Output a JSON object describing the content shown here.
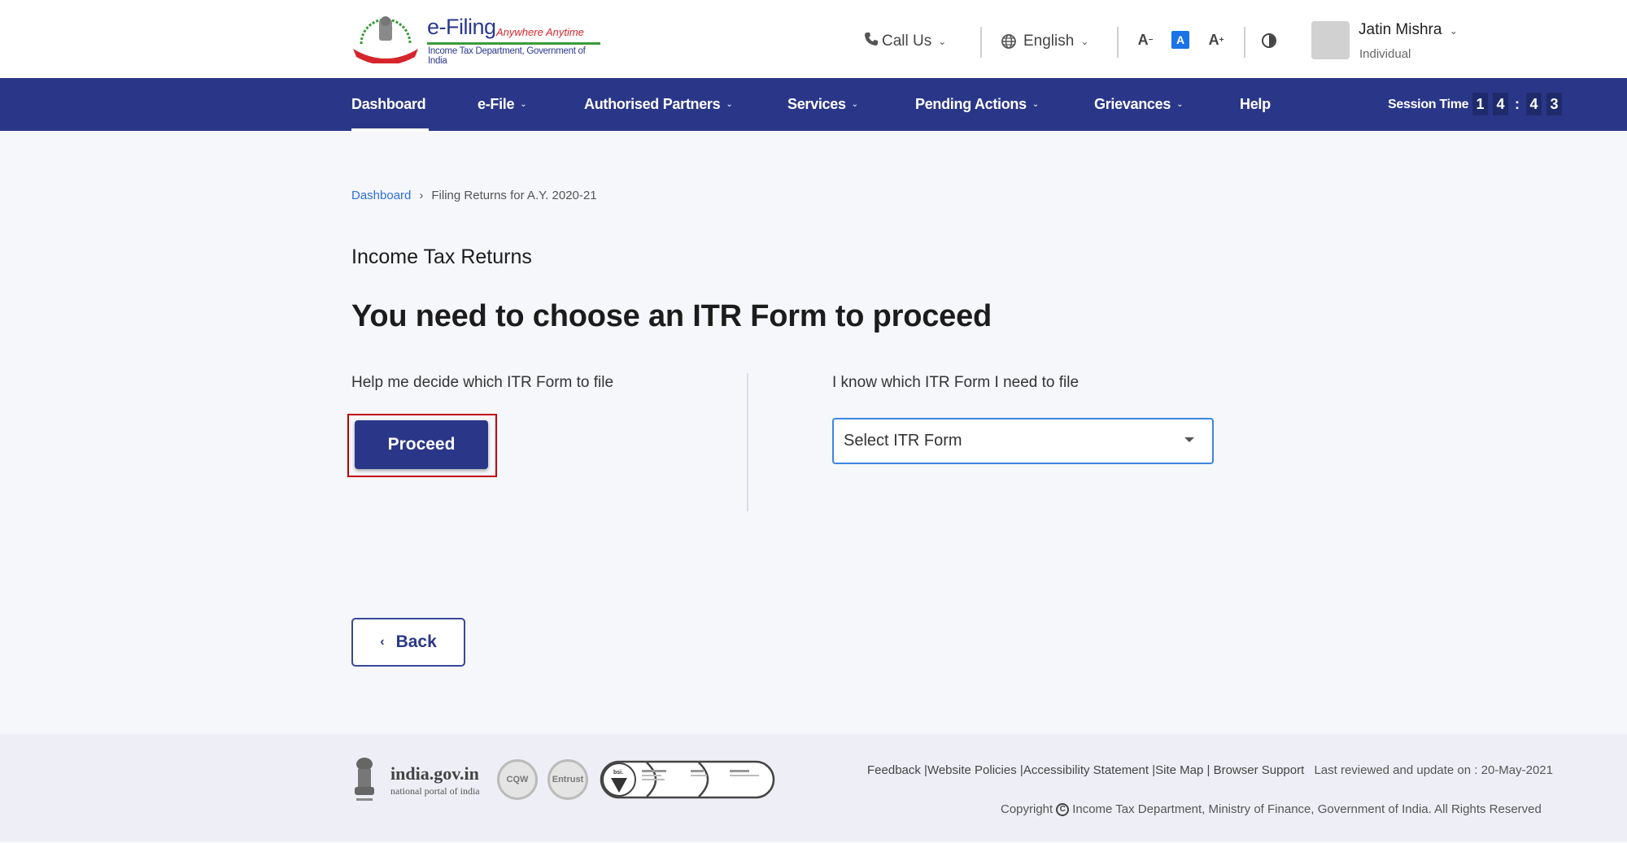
{
  "header": {
    "logo": {
      "title": "e-Filing",
      "tagline": "Anywhere Anytime",
      "subtitle": "Income Tax Department, Government of India"
    },
    "call_us_label": "Call Us",
    "language_label": "English",
    "font_controls": {
      "decrease": "A",
      "normal": "A",
      "increase": "A"
    },
    "user": {
      "name": "Jatin Mishra",
      "type": "Individual"
    }
  },
  "nav": {
    "items": [
      {
        "label": "Dashboard",
        "has_dropdown": false,
        "active": true
      },
      {
        "label": "e-File",
        "has_dropdown": true
      },
      {
        "label": "Authorised Partners",
        "has_dropdown": true
      },
      {
        "label": "Services",
        "has_dropdown": true
      },
      {
        "label": "Pending Actions",
        "has_dropdown": true
      },
      {
        "label": "Grievances",
        "has_dropdown": true
      },
      {
        "label": "Help",
        "has_dropdown": false
      }
    ],
    "session": {
      "label": "Session Time",
      "digits": [
        "1",
        "4",
        "4",
        "3"
      ],
      "display": "14:43"
    }
  },
  "breadcrumb": {
    "home": "Dashboard",
    "separator": "›",
    "current": "Filing Returns for A.Y. 2020-21"
  },
  "main": {
    "section_title": "Income Tax Returns",
    "heading": "You need to choose an ITR Form to proceed",
    "left": {
      "label": "Help me decide which ITR Form to file",
      "button": "Proceed"
    },
    "right": {
      "label": "I know which ITR Form I need to file",
      "select_placeholder": "Select ITR Form"
    },
    "back_button": "Back"
  },
  "footer": {
    "portal_name": "india.gov.in",
    "portal_sub": "national portal of india",
    "seals": [
      "CQW",
      "Entrust"
    ],
    "iso_badge": "bsi.",
    "links": [
      "Feedback",
      "Website Policies",
      "Accessibility Statement",
      "Site Map",
      "Browser Support"
    ],
    "last_reviewed": "Last reviewed and update on : 20-May-2021",
    "copyright": "Income Tax Department, Ministry of Finance, Government of India. All Rights Reserved",
    "copyright_prefix": "Copyright"
  },
  "colors": {
    "brand_navy": "#2a3788",
    "link_blue": "#2e6fd8",
    "highlight_red": "#c00000",
    "focus_blue": "#3c86e0"
  }
}
